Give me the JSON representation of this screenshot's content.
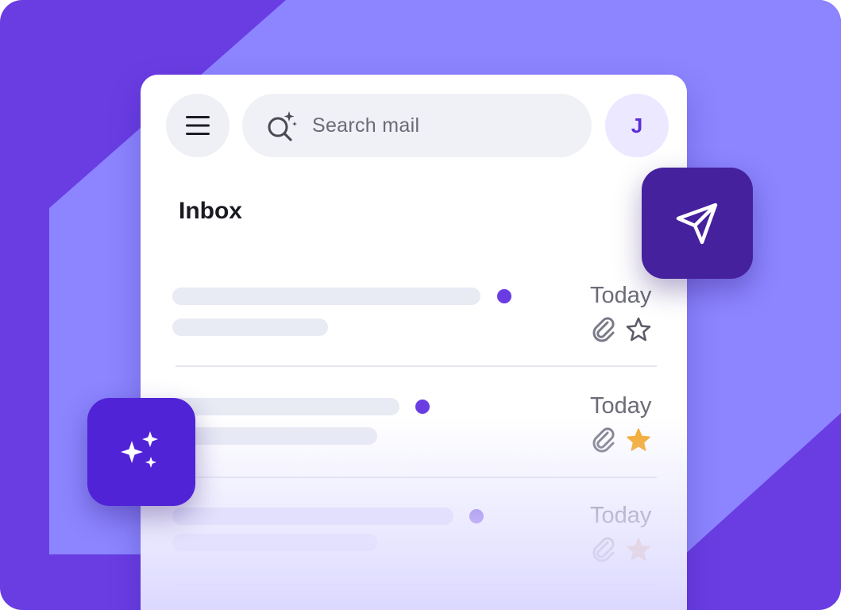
{
  "colors": {
    "background_dark": "#6a3de3",
    "background_light": "#8c85ff",
    "accent": "#6a3de3",
    "star_filled": "#f5a623",
    "send_tile": "#45219e",
    "sparkle_tile": "#5024d6"
  },
  "header": {
    "menu_icon": "hamburger-menu-icon",
    "search": {
      "icon": "search-sparkle-icon",
      "placeholder": "Search mail"
    },
    "avatar_initial": "J"
  },
  "inbox": {
    "title": "Inbox",
    "messages": [
      {
        "date": "Today",
        "unread": true,
        "attachment": true,
        "starred": false
      },
      {
        "date": "Today",
        "unread": true,
        "attachment": true,
        "starred": true
      },
      {
        "date": "Today",
        "unread": true,
        "attachment": true,
        "starred": true
      }
    ]
  },
  "floating": {
    "send_icon": "paper-plane-icon",
    "sparkle_icon": "sparkles-icon"
  }
}
